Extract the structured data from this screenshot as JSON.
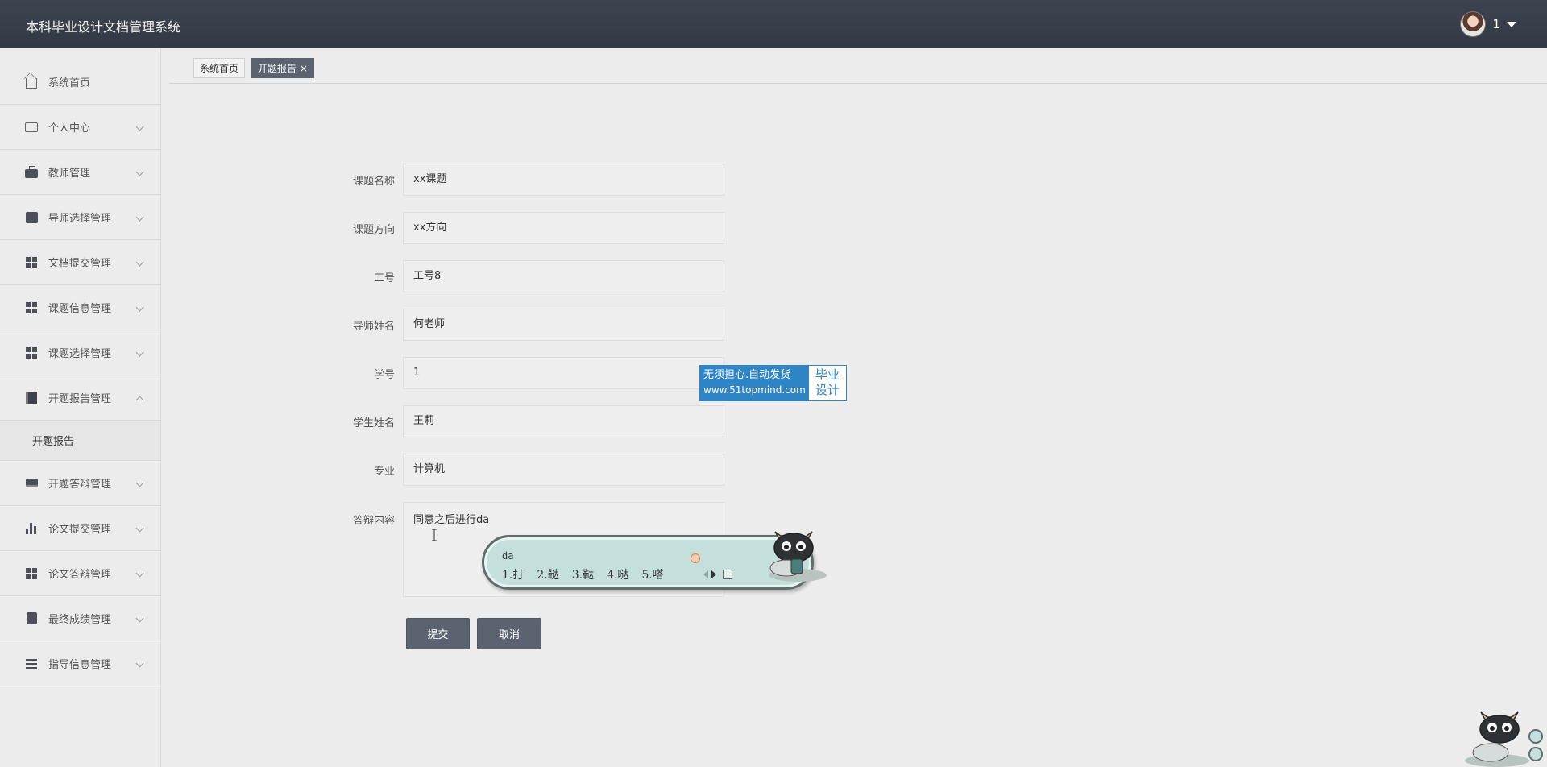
{
  "app": {
    "title": "本科毕业设计文档管理系统"
  },
  "user": {
    "name": "1"
  },
  "sidebar": {
    "items": [
      {
        "label": "系统首页",
        "icon": "home-icon"
      },
      {
        "label": "个人中心",
        "icon": "id-card-icon"
      },
      {
        "label": "教师管理",
        "icon": "briefcase-icon"
      },
      {
        "label": "导师选择管理",
        "icon": "chart-icon"
      },
      {
        "label": "文档提交管理",
        "icon": "grid-icon"
      },
      {
        "label": "课题信息管理",
        "icon": "grid-icon"
      },
      {
        "label": "课题选择管理",
        "icon": "grid-icon"
      },
      {
        "label": "开题报告管理",
        "icon": "book-icon"
      },
      {
        "label": "开题答辩管理",
        "icon": "monitor-icon"
      },
      {
        "label": "论文提交管理",
        "icon": "bar-chart-icon"
      },
      {
        "label": "论文答辩管理",
        "icon": "grid-icon"
      },
      {
        "label": "最终成绩管理",
        "icon": "clipboard-icon"
      },
      {
        "label": "指导信息管理",
        "icon": "list-icon"
      }
    ],
    "sub_item": "开题报告"
  },
  "tabs": [
    {
      "label": "系统首页"
    },
    {
      "label": "开题报告 ×"
    }
  ],
  "form": {
    "fields": [
      {
        "label": "课题名称",
        "value": "xx课题"
      },
      {
        "label": "课题方向",
        "value": "xx方向"
      },
      {
        "label": "工号",
        "value": "工号8"
      },
      {
        "label": "导师姓名",
        "value": "何老师"
      },
      {
        "label": "学号",
        "value": "1"
      },
      {
        "label": "学生姓名",
        "value": "王莉"
      },
      {
        "label": "专业",
        "value": "计算机"
      }
    ],
    "content_label": "答辩内容",
    "content_value": "同意之后进行da",
    "submit_label": "提交",
    "cancel_label": "取消"
  },
  "watermark": {
    "line1": "无须担心.自动发货",
    "line2": "www.51topmind.com",
    "side1": "毕业",
    "side2": "设计"
  },
  "ime": {
    "composition": "da",
    "candidates": [
      "1.打",
      "2.鞑",
      "3.鞑",
      "4.哒",
      "5.嗒"
    ]
  }
}
